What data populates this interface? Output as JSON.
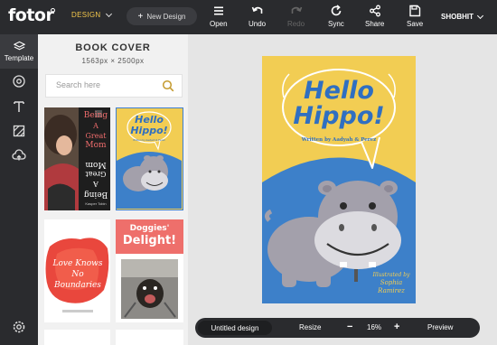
{
  "app": {
    "logo": "fotor",
    "design_menu": "DESIGN",
    "new_design": "New Design",
    "user": "SHOBHIT"
  },
  "toolbar": {
    "open": "Open",
    "undo": "Undo",
    "redo": "Redo",
    "sync": "Sync",
    "share": "Share",
    "save": "Save"
  },
  "rail": {
    "template_label": "Template",
    "icons": [
      "template-icon",
      "circle-icon",
      "text-icon",
      "background-icon",
      "cloud-upload-icon",
      "settings-icon"
    ]
  },
  "panel": {
    "title": "BOOK COVER",
    "size": "1563px × 2500px",
    "search_placeholder": "Search here"
  },
  "thumbnails": {
    "t1": {
      "line1": "Being",
      "line2": "A Great",
      "line3": "Mom",
      "author": "Kasper Tobin"
    },
    "t2": {
      "line1": "Hello",
      "line2": "Hippo!",
      "author": "Written by Aadyah & Perez"
    },
    "t3": {
      "line1": "Love Knows",
      "line2": "No Boundaries"
    },
    "t4": {
      "line1": "Doggies'",
      "line2": "Delight!"
    }
  },
  "cover": {
    "title_line1": "Hello",
    "title_line2": "Hippo!",
    "byline": "Written by Aadyah & Perez",
    "illustrated_by": "Illustrated by",
    "illustrator": "Sophia Ramirez"
  },
  "bottom": {
    "file_name": "Untitled design",
    "resize": "Resize",
    "zoom_minus": "−",
    "zoom": "16%",
    "zoom_plus": "+",
    "preview": "Preview"
  },
  "colors": {
    "topbar": "#2a2b2e",
    "accent": "#f5c84b",
    "cover_yellow": "#f2cd53",
    "cover_blue": "#3d80c9",
    "hippo": "#a3a0ab",
    "selection": "#3f7fd0"
  }
}
